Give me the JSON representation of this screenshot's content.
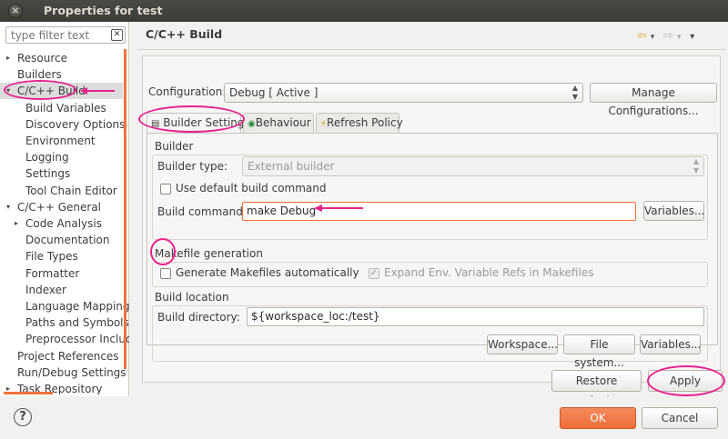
{
  "window": {
    "title": "Properties for test",
    "close_glyph": "×"
  },
  "filter": {
    "placeholder": "type filter text",
    "clear_glyph": "✕"
  },
  "tree": {
    "items": [
      {
        "label": "Resource",
        "indent": 0,
        "expander": "▸"
      },
      {
        "label": "Builders",
        "indent": 0,
        "expander": ""
      },
      {
        "label": "C/C++ Build",
        "indent": 0,
        "expander": "▾",
        "selected": true
      },
      {
        "label": "Build Variables",
        "indent": 1,
        "expander": ""
      },
      {
        "label": "Discovery Options",
        "indent": 1,
        "expander": ""
      },
      {
        "label": "Environment",
        "indent": 1,
        "expander": ""
      },
      {
        "label": "Logging",
        "indent": 1,
        "expander": ""
      },
      {
        "label": "Settings",
        "indent": 1,
        "expander": ""
      },
      {
        "label": "Tool Chain Editor",
        "indent": 1,
        "expander": ""
      },
      {
        "label": "C/C++ General",
        "indent": 0,
        "expander": "▾"
      },
      {
        "label": "Code Analysis",
        "indent": 1,
        "expander": "▸"
      },
      {
        "label": "Documentation",
        "indent": 1,
        "expander": ""
      },
      {
        "label": "File Types",
        "indent": 1,
        "expander": ""
      },
      {
        "label": "Formatter",
        "indent": 1,
        "expander": ""
      },
      {
        "label": "Indexer",
        "indent": 1,
        "expander": ""
      },
      {
        "label": "Language Mappings",
        "indent": 1,
        "expander": ""
      },
      {
        "label": "Paths and Symbols",
        "indent": 1,
        "expander": ""
      },
      {
        "label": "Preprocessor Includ",
        "indent": 1,
        "expander": ""
      },
      {
        "label": "Project References",
        "indent": 0,
        "expander": ""
      },
      {
        "label": "Run/Debug Settings",
        "indent": 0,
        "expander": ""
      },
      {
        "label": "Task Repository",
        "indent": 0,
        "expander": "▸"
      }
    ]
  },
  "page": {
    "title": "C/C++ Build",
    "nav": {
      "back": "⇦",
      "back_menu": "▾",
      "forward": "⇨",
      "forward_menu": "▾",
      "menu": "▾"
    }
  },
  "configuration": {
    "label": "Configuration:",
    "value": "Debug  [ Active ]",
    "combo_arrow": "⌃⌄",
    "manage_label": "Manage Configurations..."
  },
  "tabs": [
    {
      "label": "Builder Settings",
      "active": true
    },
    {
      "label": "Behaviour",
      "active": false
    },
    {
      "label": "Refresh Policy",
      "active": false
    }
  ],
  "builder": {
    "group_label": "Builder",
    "type_label": "Builder type:",
    "type_value": "External builder",
    "use_default_label": "Use default build command",
    "command_label": "Build command:",
    "command_value": "make Debug",
    "variables_label": "Variables..."
  },
  "makefile": {
    "group_label": "Makefile generation",
    "generate_label": "Generate Makefiles automatically",
    "expand_label": "Expand Env. Variable Refs in Makefiles",
    "expand_checkmark": "✓"
  },
  "location": {
    "group_label": "Build location",
    "directory_label": "Build directory:",
    "directory_value": "${workspace_loc:/test}",
    "workspace_label": "Workspace...",
    "filesystem_label": "File system...",
    "variables_label": "Variables..."
  },
  "actions": {
    "restore_defaults": "Restore Defaults",
    "apply": "Apply"
  },
  "footer": {
    "help_glyph": "?",
    "ok": "OK",
    "cancel": "Cancel"
  },
  "colors": {
    "accent_orange": "#ee6f3a",
    "annotation_pink": "#e7218e"
  }
}
